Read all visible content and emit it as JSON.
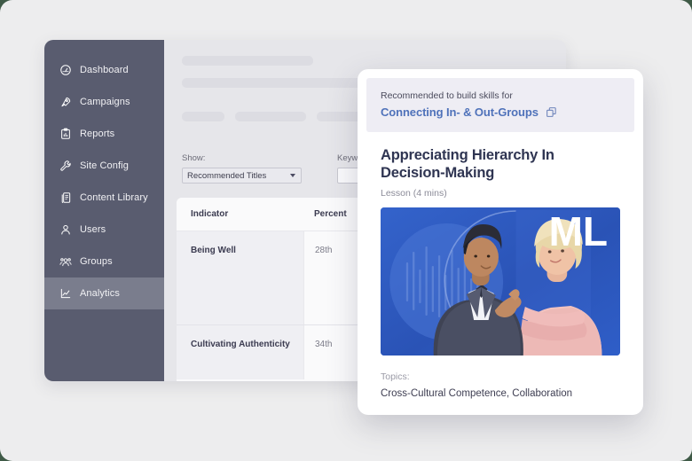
{
  "sidebar": {
    "items": [
      {
        "label": "Dashboard",
        "icon": "dashboard-gauge-icon",
        "active": false
      },
      {
        "label": "Campaigns",
        "icon": "rocket-icon",
        "active": false
      },
      {
        "label": "Reports",
        "icon": "clipboard-chart-icon",
        "active": false
      },
      {
        "label": "Site Config",
        "icon": "wrench-icon",
        "active": false
      },
      {
        "label": "Content Library",
        "icon": "documents-icon",
        "active": false
      },
      {
        "label": "Users",
        "icon": "user-icon",
        "active": false
      },
      {
        "label": "Groups",
        "icon": "users-group-icon",
        "active": false
      },
      {
        "label": "Analytics",
        "icon": "line-chart-icon",
        "active": true
      }
    ]
  },
  "filters": {
    "show_label": "Show:",
    "show_value": "Recommended Titles",
    "keyword_label": "Keyword S",
    "keyword_value": "",
    "keyword_placeholder": ""
  },
  "table": {
    "headers": [
      "Indicator",
      "Percent"
    ],
    "rows": [
      {
        "indicator": "Being Well",
        "percentile": "28th"
      },
      {
        "indicator": "Cultivating Authenticity",
        "percentile": "34th"
      }
    ]
  },
  "card": {
    "banner_sub": "Recommended to build skills for",
    "banner_link": "Connecting In- & Out-Groups",
    "banner_icon": "copy-icon",
    "title": "Appreciating Hierarchy In Decision-Making",
    "meta": "Lesson (4 mins)",
    "thumbnail_badge": "ML",
    "topics_label": "Topics:",
    "topics_value": "Cross-Cultural Competence, Collaboration"
  },
  "colors": {
    "sidebar_bg": "#595c6f",
    "sidebar_active": "#7a7d8d",
    "panel_bg": "#e6e6ea",
    "canvas_bg": "#ededee",
    "page_bg": "#3f5a47",
    "link_blue": "#4f72ba",
    "title_navy": "#2f3552",
    "banner_bg": "#eeedf4",
    "thumb_blue": "#2f5fc4"
  }
}
